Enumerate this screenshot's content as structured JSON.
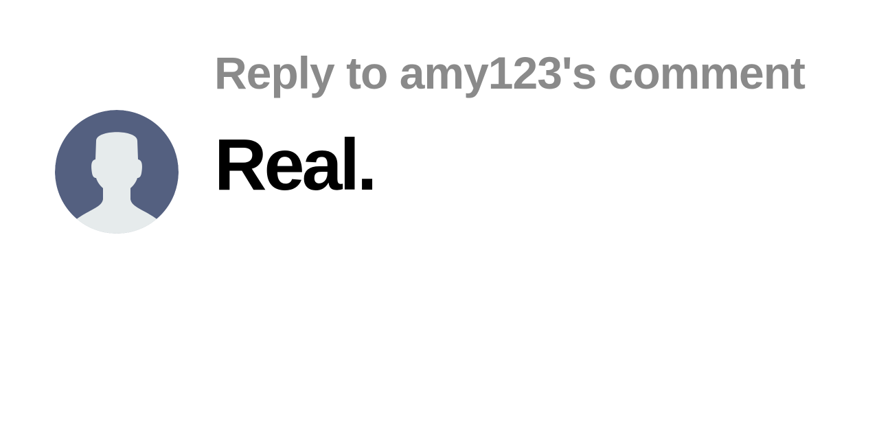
{
  "comment": {
    "reply_context": "Reply to amy123's comment",
    "text": "Real.",
    "avatar_icon": "default-user-avatar-icon"
  },
  "colors": {
    "avatar_background": "#546080",
    "avatar_silhouette": "#e6ebec",
    "reply_context_text": "#8a8a8a",
    "comment_text": "#000000"
  }
}
